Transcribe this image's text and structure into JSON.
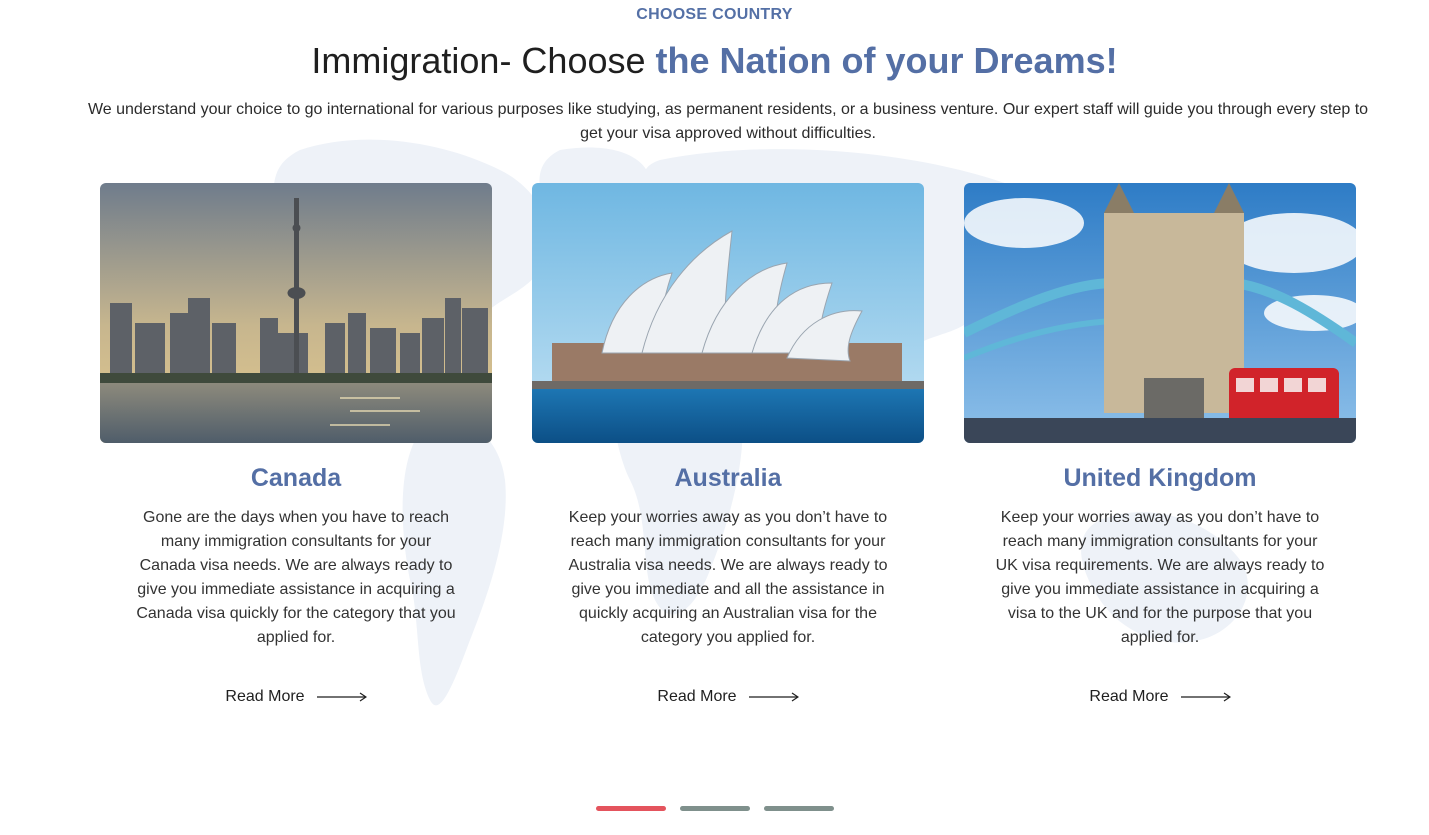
{
  "section": {
    "eyebrow": "CHOOSE COUNTRY",
    "headline_plain": "Immigration- Choose ",
    "headline_accent": "the Nation of your Dreams!",
    "intro": "We understand your choice to go international for various purposes like studying, as permanent residents, or a business venture. Our expert staff will guide you through every step to get your visa approved without difficulties."
  },
  "cards": [
    {
      "title": "Canada",
      "description": "Gone are the days when you have to reach many immigration consultants for your Canada visa needs. We are always ready to give you immediate assistance in acquiring a Canada visa quickly for the category that you applied for.",
      "link_label": "Read More"
    },
    {
      "title": "Australia",
      "description": "Keep your worries away as you don’t have to reach many immigration consultants for your Australia visa needs. We are always ready to give you immediate and all the assistance in quickly acquiring an Australian visa for the category you applied for.",
      "link_label": "Read More"
    },
    {
      "title": "United Kingdom",
      "description": "Keep your worries away as you don’t have to reach many immigration consultants for your UK visa requirements. We are always ready to give you immediate assistance in acquiring a visa to the UK and for the purpose that you applied for.",
      "link_label": "Read More"
    }
  ],
  "pager": {
    "total": 3,
    "active_index": 0
  },
  "colors": {
    "accent": "#546fa5",
    "pager_active": "#e4545d",
    "pager_inactive": "#7f908c",
    "map_tint": "#eef2f8"
  },
  "icons": {
    "read_more": "arrow-right-icon",
    "background": "world-map-icon"
  }
}
